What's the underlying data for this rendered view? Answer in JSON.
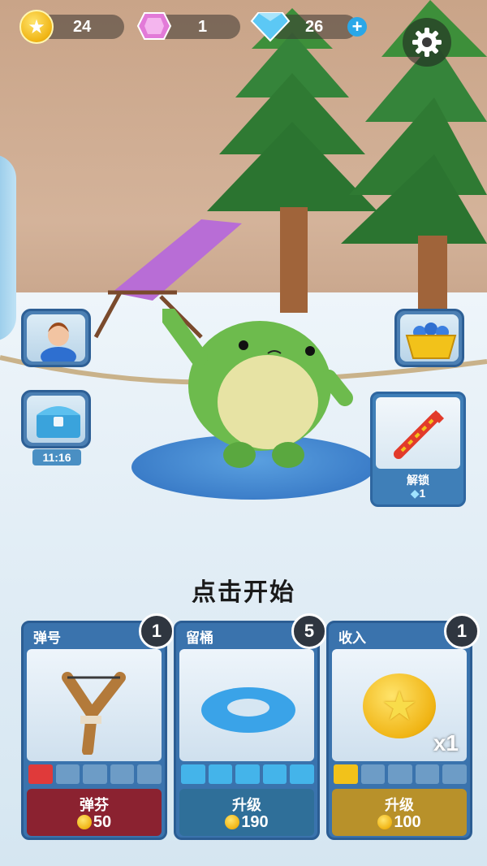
{
  "hud": {
    "coins": "24",
    "pink_gems": "1",
    "diamonds": "26",
    "diamonds_plus": "+"
  },
  "side": {
    "chest_timer": "11:16",
    "rocket_label": "解锁",
    "rocket_cost": "1"
  },
  "start_text": "点击开始",
  "cards": [
    {
      "title": "弹号",
      "level": "1",
      "button_label": "弹芬",
      "price": "50",
      "filled_bars": 1,
      "bar_color": "#e03a3a",
      "button_color": "#8b2230"
    },
    {
      "title": "留桶",
      "level": "5",
      "button_label": "升级",
      "price": "190",
      "filled_bars": 5,
      "bar_color": "#44b4ea",
      "button_color": "#2f6f99"
    },
    {
      "title": "收入",
      "level": "1",
      "button_label": "升级",
      "price": "100",
      "filled_bars": 1,
      "bar_color": "#f2c21a",
      "button_color": "#b8912a",
      "multiplier": "x1"
    }
  ],
  "icons": {
    "coin": "coin-icon",
    "pink_gem": "pink-gem-icon",
    "diamond": "diamond-icon",
    "settings": "gear-icon",
    "avatar": "avatar-icon",
    "chest": "chest-icon",
    "basket": "basket-icon",
    "rocket": "rocket-icon"
  }
}
